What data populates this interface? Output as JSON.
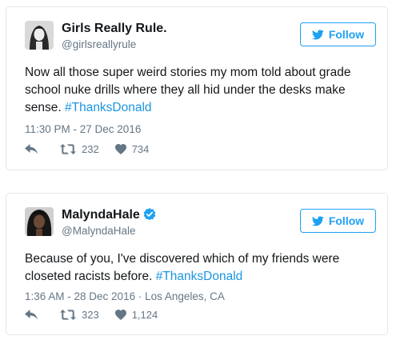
{
  "tweets": [
    {
      "display_name": "Girls Really Rule.",
      "handle": "@girlsreallyrule",
      "verified": false,
      "follow_label": "Follow",
      "text": "Now all those super weird stories my mom told about grade school nuke drills where they all hid under the desks make sense. ",
      "hashtag": "#ThanksDonald",
      "timestamp": "11:30 PM - 27 Dec 2016",
      "retweets": "232",
      "likes": "734"
    },
    {
      "display_name": "MalyndaHale",
      "handle": "@MalyndaHale",
      "verified": true,
      "follow_label": "Follow",
      "text": "Because of you, I've discovered which of my friends were closeted racists before. ",
      "hashtag": "#ThanksDonald",
      "timestamp": "1:36 AM - 28 Dec 2016 · Los Angeles, CA",
      "retweets": "323",
      "likes": "1,124"
    }
  ],
  "colors": {
    "accent": "#1da1f2",
    "hashtag": "#1b95e0",
    "muted": "#657786",
    "text": "#14171a",
    "verified": "#1da1f2"
  },
  "icons": {
    "bird": "twitter-bird-icon",
    "reply": "reply-icon",
    "retweet": "retweet-icon",
    "like": "heart-icon",
    "verified": "verified-badge-icon"
  }
}
